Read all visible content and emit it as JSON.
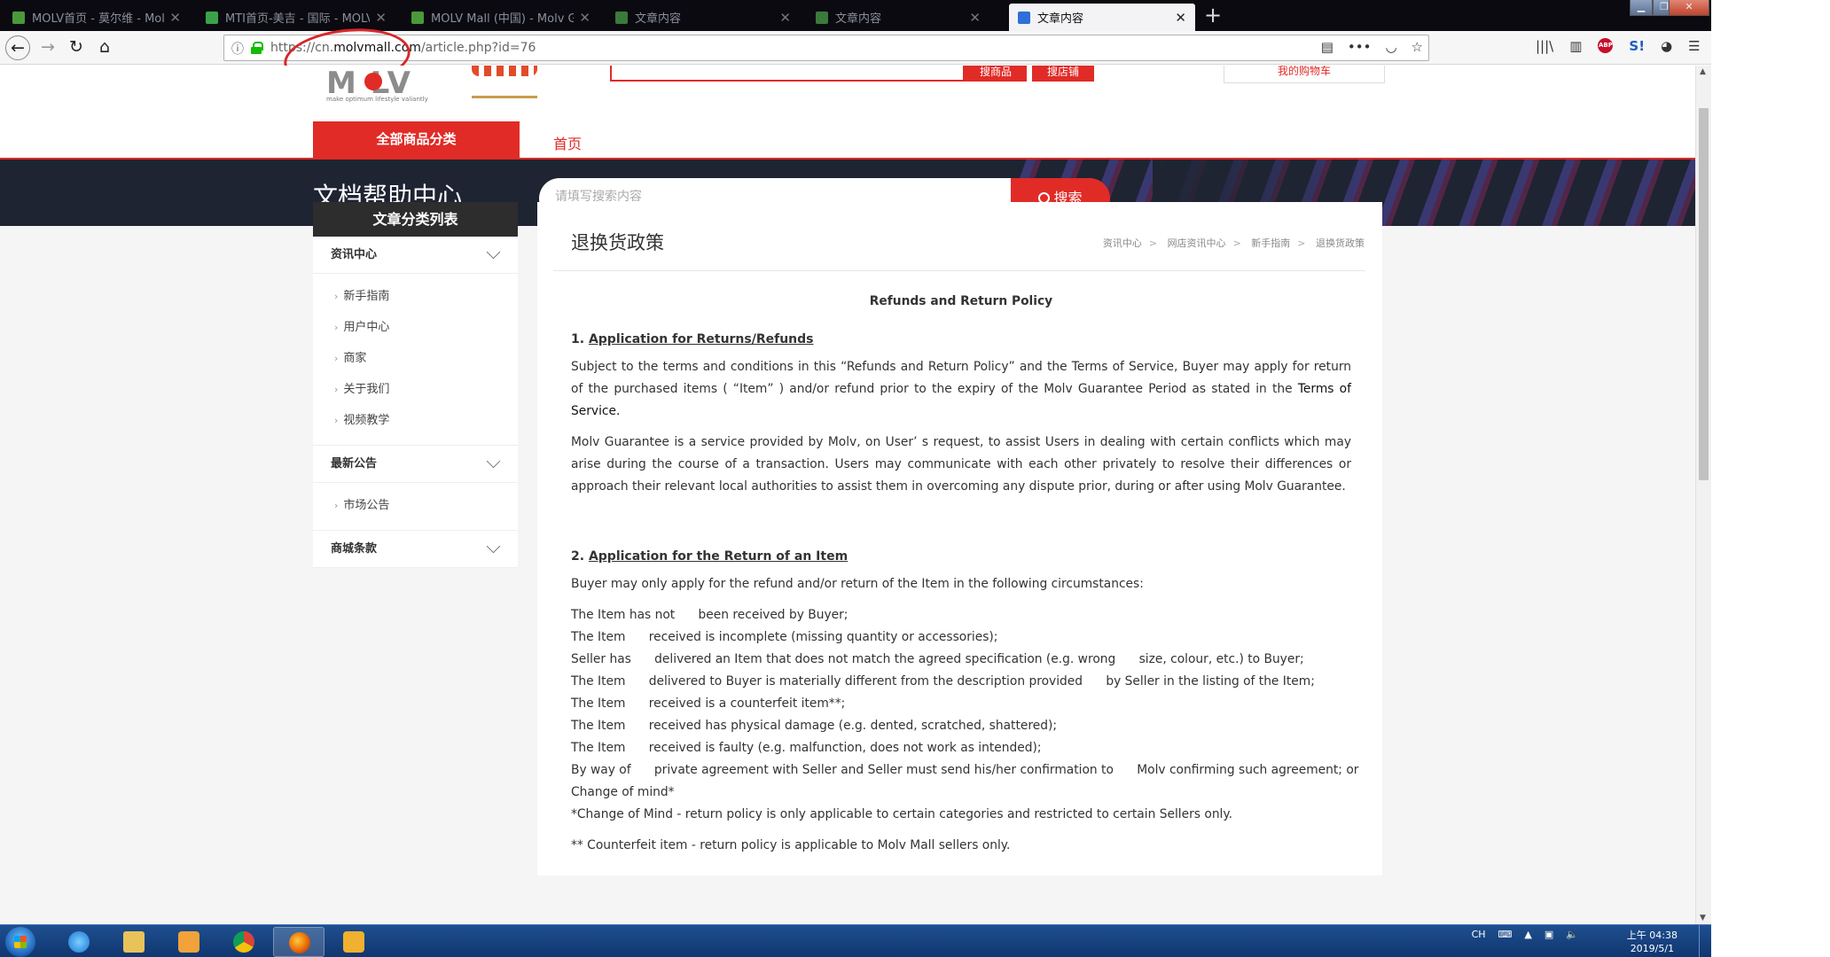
{
  "browser": {
    "tabs": [
      {
        "title": "MOLV首页 - 莫尔维 - Molv",
        "icon_color": "#4a9a3a"
      },
      {
        "title": "MTI首页-美吉 - 国际 - MOLV",
        "icon_color": "#3aa34a"
      },
      {
        "title": "MOLV Mall (中国) - Molv G...",
        "icon_color": "#4a9a3a"
      },
      {
        "title": "文章内容",
        "icon_color": "#3a7a3a"
      },
      {
        "title": "文章内容",
        "icon_color": "#3a7a3a"
      },
      {
        "title": "文章内容",
        "icon_color": "#2e6fd8"
      }
    ],
    "url_prefix": "https://cn.",
    "url_host": "molvmall.com",
    "url_path": "/article.php?id=76"
  },
  "header": {
    "logo": "M  LV",
    "logo_sub": "make optimum lifestyle valiantly",
    "search_goods": "搜商品",
    "search_shop": "搜店铺",
    "cart": "我的购物车",
    "all_categories": "全部商品分类",
    "home": "首页"
  },
  "banner": {
    "title": "文档帮助中心",
    "search_placeholder": "请填写搜索内容",
    "search_button": "搜索"
  },
  "sidebar": {
    "heading": "文章分类列表",
    "groups": [
      {
        "label": "资讯中心",
        "items": [
          "新手指南",
          "用户中心",
          "商家",
          "关于我们",
          "视频教学"
        ]
      },
      {
        "label": "最新公告",
        "items": [
          "市场公告"
        ]
      },
      {
        "label": "商城条款",
        "items": []
      }
    ]
  },
  "article": {
    "page_title": "退换货政策",
    "breadcrumb": [
      "资讯中心",
      "网店资讯中心",
      "新手指南",
      "退换货政策"
    ],
    "breadcrumb_sep": ">",
    "title": "Refunds and Return Policy",
    "s1_num": "1.",
    "s1_heading": "Application for Returns/Refunds",
    "s1_p1a": "Subject to the terms and conditions in this “Refunds and Return Policy” and the Terms of Service, Buyer may apply for return of the purchased items ( “Item” ) and/or refund prior to the expiry of the Molv Guarantee Period as stated in the ",
    "s1_p1_link": "Terms of Service.",
    "s1_p2": "Molv Guarantee is a service provided by Molv, on User’ s request, to assist Users in dealing with certain conflicts which may arise during the course of a transaction. Users may communicate with each other privately to resolve their differences or approach their relevant local authorities to assist them in overcoming any dispute prior, during or after using Molv Guarantee.",
    "s2_num": "2.",
    "s2_heading": "Application for the Return of an Item",
    "s2_intro": "Buyer may only apply for the refund and/or return of the Item in the following circumstances:",
    "s2_lines": [
      "The Item has not      been received by Buyer;",
      "The Item      received is incomplete (missing quantity or accessories);",
      "Seller has      delivered an Item that does not match the agreed specification (e.g. wrong      size, colour, etc.) to Buyer;",
      "The Item      delivered to Buyer is materially different from the description provided      by Seller in the listing of the Item;",
      "The Item      received is a counterfeit item**;",
      "The Item      received has physical damage (e.g. dented, scratched, shattered);",
      "The Item      received is faulty (e.g. malfunction, does not work as intended);",
      "By way of      private agreement with Seller and Seller must send his/her confirmation to      Molv confirming such agreement; or",
      "Change of mind*",
      "*Change of Mind - return policy is only applicable to certain categories and restricted to certain Sellers only."
    ],
    "s2_footnote": "** Counterfeit item - return policy is applicable to Molv Mall sellers only."
  },
  "taskbar": {
    "lang": "CH",
    "time": "上午 04:38",
    "date": "2019/5/1"
  },
  "colors": {
    "brand_red": "#e12b26",
    "banner_dark": "#1e2432",
    "sidebar_head": "#2d2d2d",
    "annotation_red": "#d8262a"
  }
}
